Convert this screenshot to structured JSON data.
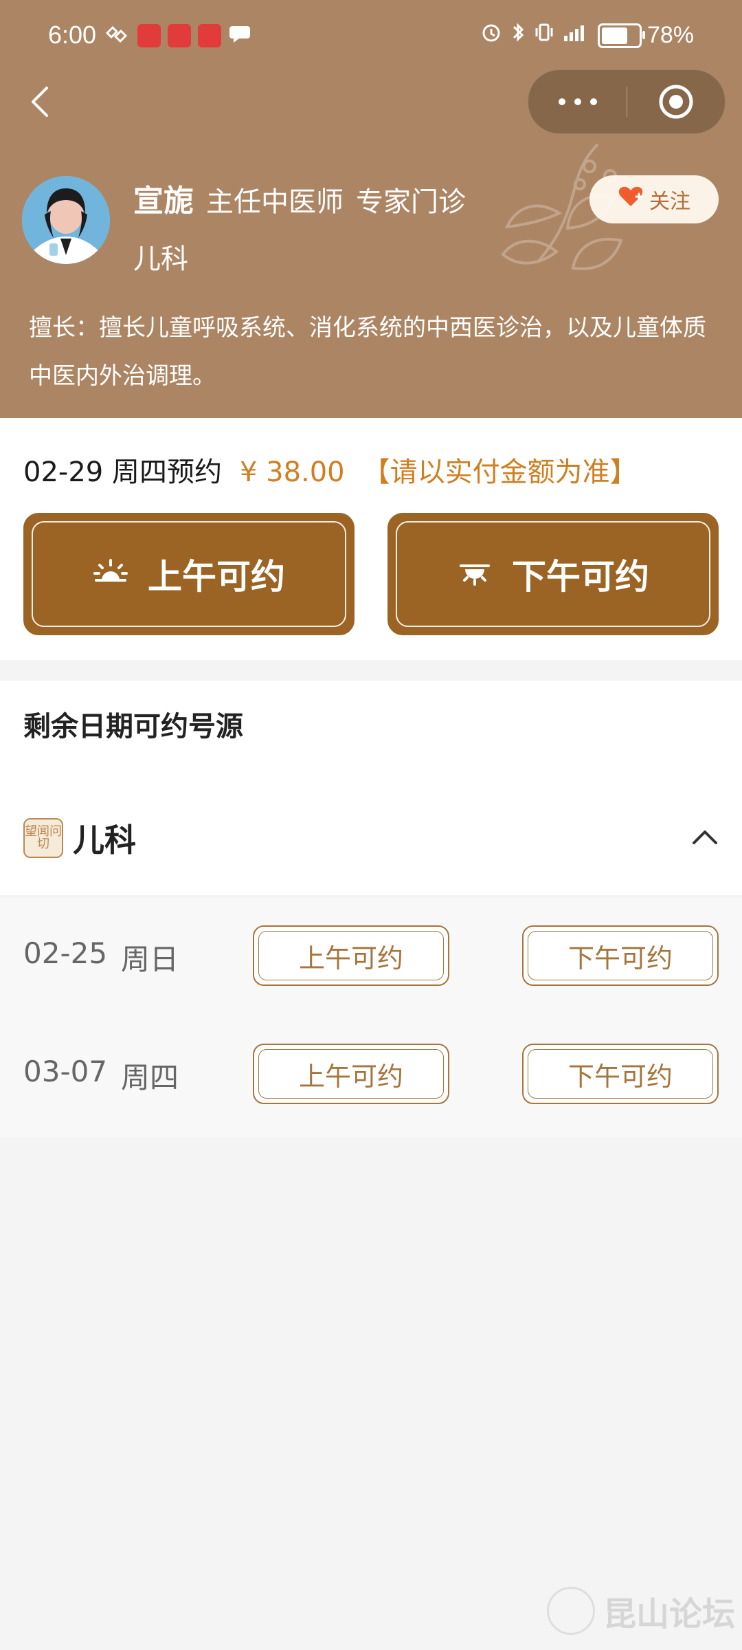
{
  "status_bar": {
    "time": "6:00",
    "battery": "78%",
    "battery_fraction": 0.78
  },
  "doctor": {
    "name": "宣旎",
    "title": "主任中医师",
    "clinic": "专家门诊",
    "department": "儿科",
    "follow_label": "关注",
    "expertise": "擅长：擅长儿童呼吸系统、消化系统的中西医诊治，以及儿童体质中医内外治调理。"
  },
  "appointment": {
    "date": "02-29 周四预约",
    "price": "¥ 38.00",
    "note": "【请以实付金额为准】",
    "morning_label": "上午可约",
    "afternoon_label": "下午可约"
  },
  "remaining": {
    "title": "剩余日期可约号源",
    "department": "儿科",
    "department_icon_text": "望闻问切",
    "rows": [
      {
        "date": "02-25",
        "weekday": "周日",
        "morning": "上午可约",
        "afternoon": "下午可约"
      },
      {
        "date": "03-07",
        "weekday": "周四",
        "morning": "上午可约",
        "afternoon": "下午可约"
      }
    ]
  },
  "watermark": {
    "text": "昆山论坛"
  }
}
